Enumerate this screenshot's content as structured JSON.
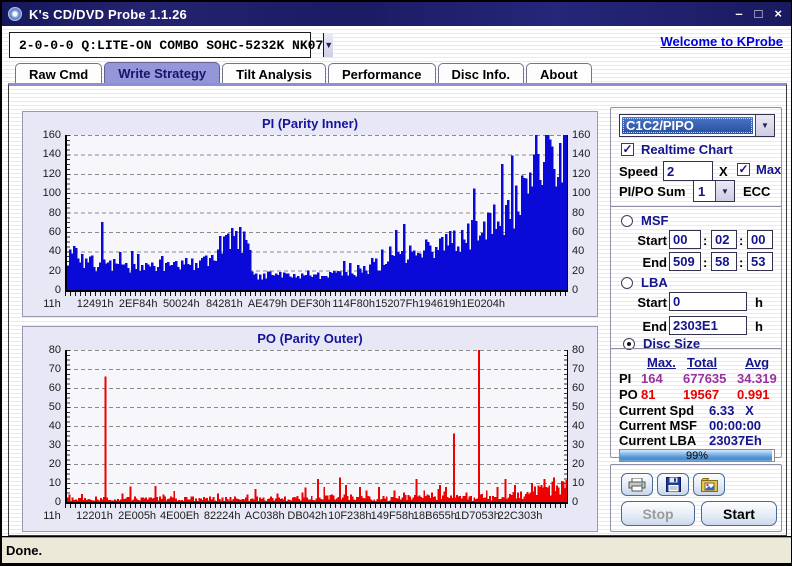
{
  "window": {
    "title": "K's CD/DVD Probe 1.1.26",
    "controls": {
      "minimize": "–",
      "maximize": "□",
      "close": "×"
    }
  },
  "header": {
    "drive_selector": "2-0-0-0 Q:LITE-ON COMBO SOHC-5232K NK07",
    "link": "Welcome to KProbe"
  },
  "tabs": [
    {
      "label": "Raw Cmd",
      "active": false
    },
    {
      "label": "Write Strategy",
      "active": true
    },
    {
      "label": "Tilt Analysis",
      "active": false
    },
    {
      "label": "Performance",
      "active": false
    },
    {
      "label": "Disc Info.",
      "active": false
    },
    {
      "label": "About",
      "active": false
    }
  ],
  "panel": {
    "mode_select": {
      "value": "C1C2/PIPO"
    },
    "realtime_chart": {
      "label": "Realtime Chart",
      "checked": true
    },
    "speed": {
      "label": "Speed",
      "value": "2",
      "unit": "X",
      "max_label": "Max",
      "max_checked": true
    },
    "pipo_sum": {
      "label": "PI/PO Sum",
      "value": "1",
      "unit": "ECC"
    },
    "msf": {
      "label": "MSF",
      "selected": false,
      "start_label": "Start",
      "end_label": "End",
      "start": [
        "00",
        "02",
        "00"
      ],
      "end": [
        "509",
        "58",
        "53"
      ],
      "separator": ":"
    },
    "lba": {
      "label": "LBA",
      "selected": false,
      "start_label": "Start",
      "end_label": "End",
      "start": "0",
      "end": "2303E1",
      "unit": "h"
    },
    "disc_size": {
      "label": "Disc Size",
      "selected": true
    },
    "stats": {
      "headers": [
        "Max.",
        "Total",
        "Avg"
      ],
      "rows": [
        {
          "label": "PI",
          "color": "#9b30a0",
          "max": "164",
          "total": "677635",
          "avg": "34.319"
        },
        {
          "label": "PO",
          "color": "#e80000",
          "max": "81",
          "total": "19567",
          "avg": "0.991"
        }
      ],
      "current": [
        {
          "label": "Current Spd",
          "value": "6.33   X"
        },
        {
          "label": "Current MSF",
          "value": "00:00:00"
        },
        {
          "label": "Current LBA",
          "value": "23037Eh"
        }
      ],
      "progress": {
        "percent": 99,
        "text": "99%"
      }
    },
    "buttons": {
      "stop": "Stop",
      "start": "Start",
      "stop_enabled": false,
      "start_enabled": true
    },
    "icons": {
      "print": "printer-icon",
      "save": "save-icon",
      "export": "chart-image-icon"
    }
  },
  "status_bar": "Done.",
  "colors": {
    "pi_bar": "#0a0ad8",
    "po_bar": "#ee0000",
    "link": "#0000dd",
    "label_navy": "#14148c",
    "pi_value": "#9b30a0",
    "po_value": "#e80000",
    "active_tab": "#9595da",
    "chart_panel": "#e7e7f5",
    "status_bg": "#ece9d8"
  },
  "chart_data": [
    {
      "id": "pi",
      "type": "bar",
      "title": "PI (Parity Inner)",
      "color": "#0a0ad8",
      "ylim": [
        0,
        160
      ],
      "ytick_step": 20,
      "grid": true,
      "x_labels": [
        "11h",
        "12491h",
        "2EF84h",
        "50024h",
        "84281h",
        "AE479h",
        "DEF30h",
        "114F80h",
        "15207Fh",
        "194619h",
        "1E0204h"
      ],
      "stats": {
        "max": 164,
        "total": 677635,
        "avg": 34.319
      },
      "bars": 250,
      "seed": 7,
      "noise": 0.3,
      "noise_type": "pi",
      "floor": 5,
      "envelope": [
        [
          0,
          36
        ],
        [
          0.012,
          40
        ],
        [
          0.03,
          29
        ],
        [
          0.06,
          25
        ],
        [
          0.1,
          26
        ],
        [
          0.14,
          25
        ],
        [
          0.18,
          24
        ],
        [
          0.22,
          25
        ],
        [
          0.26,
          26
        ],
        [
          0.285,
          29
        ],
        [
          0.3,
          40
        ],
        [
          0.315,
          45
        ],
        [
          0.33,
          48
        ],
        [
          0.345,
          50
        ],
        [
          0.358,
          52
        ],
        [
          0.364,
          48
        ],
        [
          0.368,
          14
        ],
        [
          0.4,
          15
        ],
        [
          0.45,
          15
        ],
        [
          0.5,
          16
        ],
        [
          0.54,
          17
        ],
        [
          0.58,
          20
        ],
        [
          0.62,
          24
        ],
        [
          0.65,
          30
        ],
        [
          0.675,
          38
        ],
        [
          0.695,
          40
        ],
        [
          0.71,
          37
        ],
        [
          0.73,
          41
        ],
        [
          0.75,
          45
        ],
        [
          0.77,
          48
        ],
        [
          0.79,
          52
        ],
        [
          0.81,
          57
        ],
        [
          0.83,
          62
        ],
        [
          0.85,
          67
        ],
        [
          0.87,
          74
        ],
        [
          0.89,
          82
        ],
        [
          0.91,
          92
        ],
        [
          0.93,
          102
        ],
        [
          0.95,
          114
        ],
        [
          0.97,
          128
        ],
        [
          0.985,
          140
        ],
        [
          1,
          150
        ]
      ],
      "spikes": [
        [
          0.068,
          70
        ],
        [
          0.105,
          39
        ],
        [
          0.14,
          37
        ],
        [
          0.19,
          35
        ],
        [
          0.235,
          33
        ],
        [
          0.27,
          33
        ],
        [
          0.305,
          56
        ],
        [
          0.347,
          65
        ],
        [
          0.565,
          28
        ],
        [
          0.61,
          33
        ],
        [
          0.645,
          45
        ],
        [
          0.658,
          62
        ],
        [
          0.673,
          68
        ],
        [
          0.72,
          52
        ],
        [
          0.76,
          58
        ],
        [
          0.79,
          62
        ],
        [
          0.817,
          105
        ],
        [
          0.845,
          80
        ],
        [
          0.873,
          130
        ],
        [
          0.9,
          108
        ],
        [
          0.918,
          115
        ],
        [
          0.936,
          140
        ],
        [
          0.955,
          132
        ],
        [
          0.972,
          148
        ],
        [
          0.988,
          152
        ],
        [
          0.998,
          160
        ]
      ]
    },
    {
      "id": "po",
      "type": "bar",
      "title": "PO (Parity Outer)",
      "color": "#ee0000",
      "ylim": [
        0,
        80
      ],
      "ytick_step": 10,
      "grid": true,
      "x_labels": [
        "11h",
        "12201h",
        "2E005h",
        "4E00Eh",
        "82224h",
        "AC038h",
        "DB042h",
        "10F238h",
        "149F58h",
        "18B655h",
        "1D7053h",
        "22C303h"
      ],
      "stats": {
        "max": 81,
        "total": 19567,
        "avg": 0.991
      },
      "bars": 320,
      "seed": 13,
      "noise": 0.9,
      "noise_type": "po",
      "floor": 0.5,
      "envelope": [
        [
          0,
          1.6
        ],
        [
          0.45,
          1.8
        ],
        [
          0.5,
          2.2
        ],
        [
          0.55,
          2.4
        ],
        [
          0.6,
          2.0
        ],
        [
          0.65,
          2.1
        ],
        [
          0.7,
          2.4
        ],
        [
          0.76,
          2.4
        ],
        [
          0.8,
          2.0
        ],
        [
          0.85,
          2.6
        ],
        [
          0.88,
          3.2
        ],
        [
          0.91,
          4.2
        ],
        [
          0.94,
          5.2
        ],
        [
          0.97,
          6.2
        ],
        [
          1,
          7.0
        ]
      ],
      "spikes": [
        [
          0.075,
          66
        ],
        [
          0.19,
          4
        ],
        [
          0.3,
          4.5
        ],
        [
          0.36,
          4
        ],
        [
          0.42,
          4.5
        ],
        [
          0.47,
          5
        ],
        [
          0.5,
          12
        ],
        [
          0.515,
          8
        ],
        [
          0.545,
          13
        ],
        [
          0.558,
          9
        ],
        [
          0.585,
          8
        ],
        [
          0.6,
          6
        ],
        [
          0.625,
          8
        ],
        [
          0.655,
          6
        ],
        [
          0.675,
          5
        ],
        [
          0.7,
          12
        ],
        [
          0.715,
          6
        ],
        [
          0.73,
          5
        ],
        [
          0.745,
          9
        ],
        [
          0.758,
          8
        ],
        [
          0.775,
          36
        ],
        [
          0.8,
          5
        ],
        [
          0.825,
          81
        ],
        [
          0.84,
          6
        ],
        [
          0.862,
          8
        ],
        [
          0.878,
          12
        ],
        [
          0.895,
          9
        ],
        [
          0.93,
          10
        ],
        [
          0.955,
          12
        ],
        [
          0.975,
          13
        ],
        [
          0.99,
          11
        ]
      ]
    }
  ]
}
